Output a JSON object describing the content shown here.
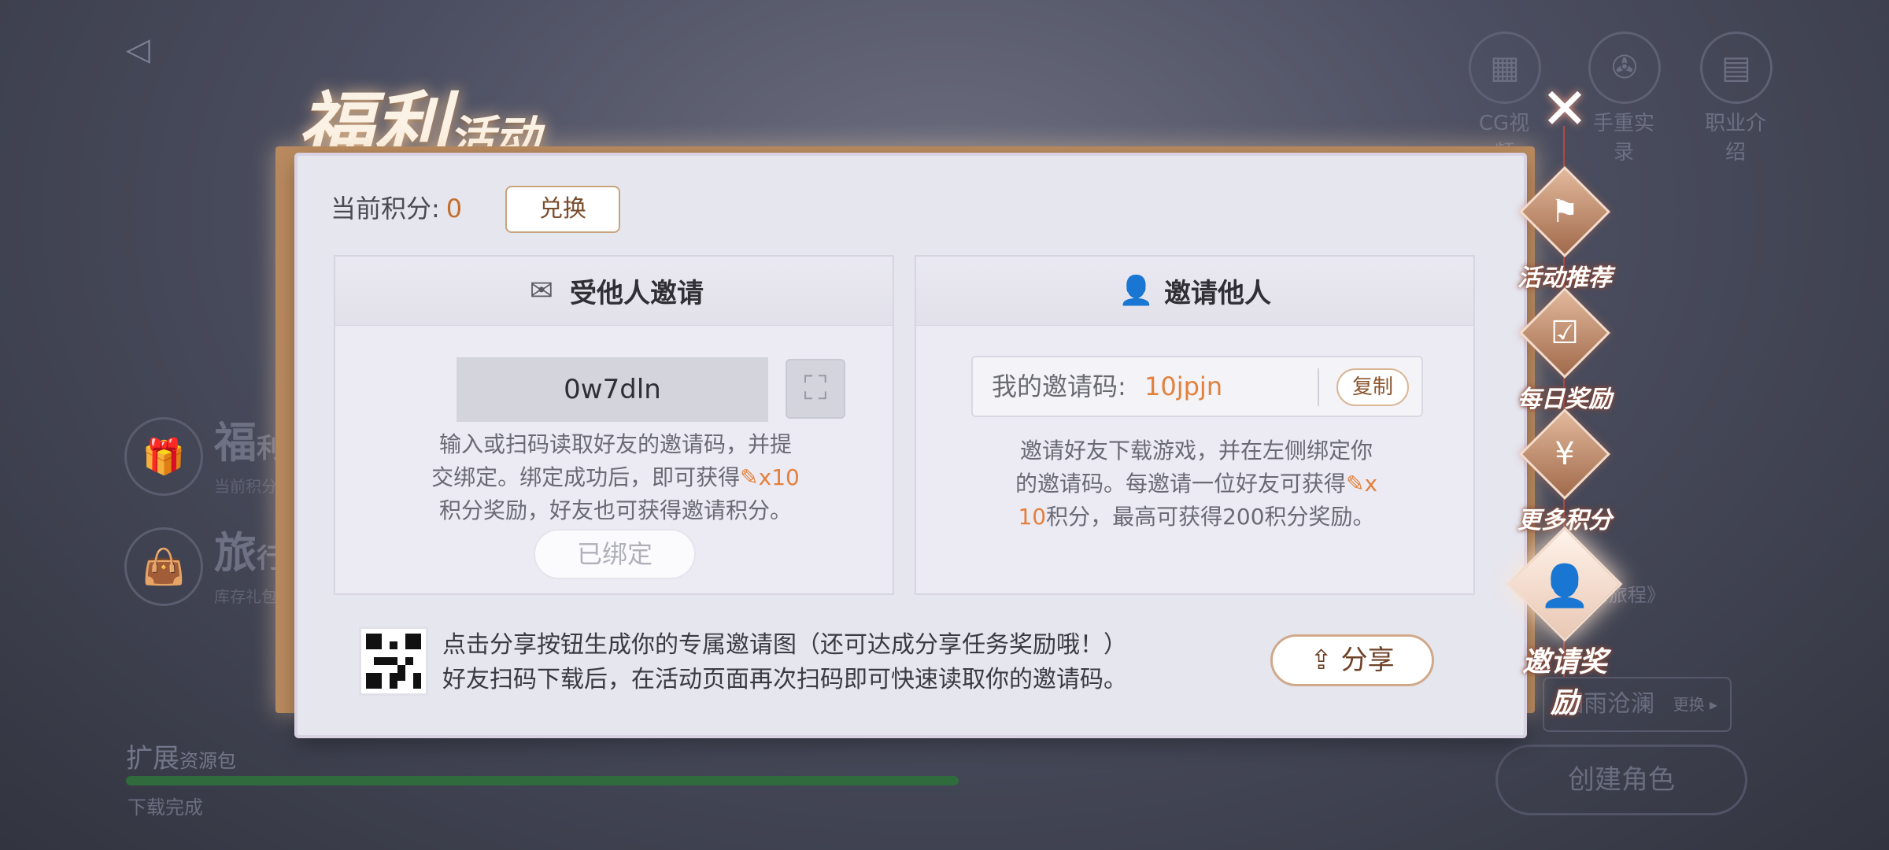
{
  "background": {
    "back_icon": "back-arrow-icon",
    "top_icons": [
      {
        "icon": "film-icon",
        "label": "CG视频"
      },
      {
        "icon": "reel-icon",
        "label": "手重实录"
      },
      {
        "icon": "book-icon",
        "label": "职业介绍"
      }
    ],
    "side_entries": [
      {
        "icon": "gift-icon",
        "big": "福",
        "big_rest": "利",
        "small": "当前积分"
      },
      {
        "icon": "bag-icon",
        "big": "旅",
        "big_rest": "行",
        "small": "库存礼包"
      }
    ],
    "pack_title": "扩展",
    "pack_subtitle": "资源包",
    "download_status": "下载完成",
    "download_progress": 1.0,
    "journey_text": "的旅程》",
    "song_name": "烟雨沧澜",
    "song_change": "更换 ▸",
    "create_role": "创建角色"
  },
  "title": {
    "main": "福利",
    "sub": "活动"
  },
  "points": {
    "label": "当前积分:",
    "value": "0",
    "exchange_button": "兑换"
  },
  "invited_card": {
    "title": "受他人邀请",
    "code_value": "0w7dln",
    "desc_line1": "输入或扫码读取好友的邀请码，并提",
    "desc_line2a": "交绑定。绑定成功后，即可获得",
    "desc_reward": "x10",
    "desc_line3": "积分奖励，好友也可获得邀请积分。",
    "bound_button": "已绑定"
  },
  "invite_card": {
    "title": "邀请他人",
    "my_code_label": "我的邀请码:",
    "my_code": "10jpjn",
    "copy_button": "复制",
    "desc_line1": "邀请好友下载游戏，并在左侧绑定你",
    "desc_line2a": "的邀请码。每邀请一位好友可获得",
    "desc_reward_a": "x",
    "desc_reward_b": "10",
    "desc_line3": "积分，最高可获得200积分奖励。"
  },
  "share": {
    "line1": "点击分享按钮生成你的专属邀请图（还可达成分享任务奖励哦！）",
    "line2": "好友扫码下载后，在活动页面再次扫码即可快速读取你的邀请码。",
    "button": "分享"
  },
  "side_menu": [
    {
      "icon": "flag-icon",
      "label": "活动推荐",
      "active": false
    },
    {
      "icon": "calendar-icon",
      "label": "每日奖励",
      "active": false
    },
    {
      "icon": "money-bag-icon",
      "label": "更多积分",
      "active": false
    },
    {
      "icon": "add-user-icon",
      "label": "邀请奖励",
      "active": true
    }
  ],
  "colors": {
    "accent": "#e3803d",
    "panel": "#e6e6ef",
    "menu_bronze": "#a16a4c"
  }
}
